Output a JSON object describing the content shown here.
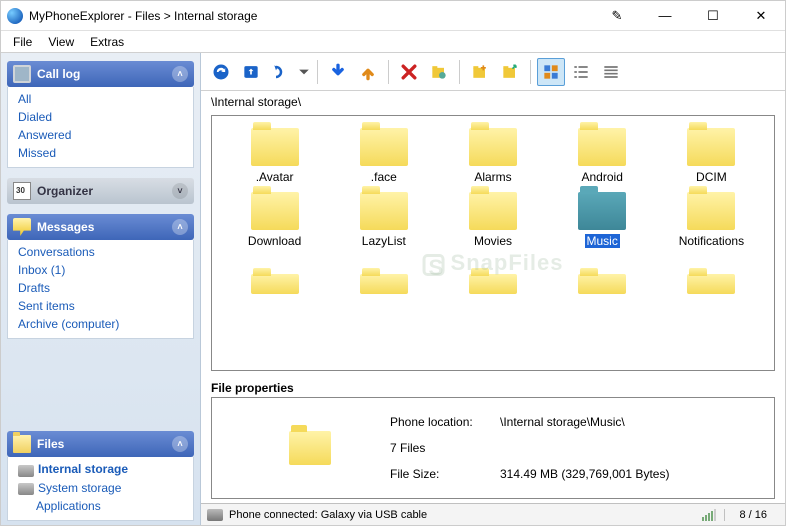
{
  "window": {
    "title": "MyPhoneExplorer -  Files > Internal storage"
  },
  "menu": {
    "file": "File",
    "view": "View",
    "extras": "Extras"
  },
  "sidebar": {
    "calllog": {
      "title": "Call log",
      "items": [
        "All",
        "Dialed",
        "Answered",
        "Missed"
      ]
    },
    "organizer": {
      "title": "Organizer"
    },
    "messages": {
      "title": "Messages",
      "items": [
        "Conversations",
        "Inbox (1)",
        "Drafts",
        "Sent items",
        "Archive (computer)"
      ]
    },
    "files": {
      "title": "Files",
      "items": [
        "Internal storage",
        "System storage",
        "Applications"
      ],
      "selected": 0
    }
  },
  "breadcrumb": "\\Internal storage\\",
  "folders": [
    {
      "name": ".Avatar"
    },
    {
      "name": ".face"
    },
    {
      "name": "Alarms"
    },
    {
      "name": "Android"
    },
    {
      "name": "DCIM"
    },
    {
      "name": "Download"
    },
    {
      "name": "LazyList"
    },
    {
      "name": "Movies"
    },
    {
      "name": "Music",
      "selected": true
    },
    {
      "name": "Notifications"
    }
  ],
  "watermark": "SnapFiles",
  "fileprops": {
    "title": "File properties",
    "location_label": "Phone location:",
    "location_value": "\\Internal storage\\Music\\",
    "count": "7 Files",
    "size_label": "File Size:",
    "size_value": "314.49 MB   (329,769,001 Bytes)"
  },
  "status": {
    "text": "Phone connected: Galaxy via USB cable",
    "page": "8 / 16"
  }
}
